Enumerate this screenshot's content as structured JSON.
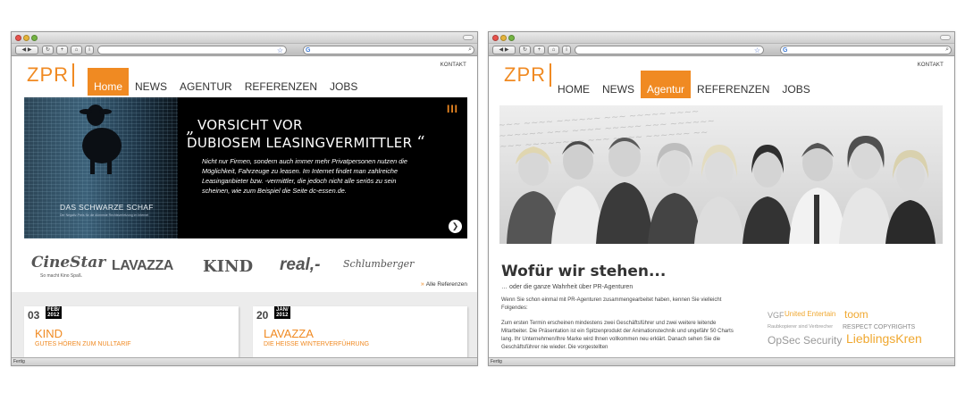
{
  "statusbar": {
    "text": "Fertig"
  },
  "left": {
    "kontakt": "KONTAKT",
    "logo": "ZPR",
    "nav": [
      "Home",
      "NEWS",
      "AGENTUR",
      "REFERENZEN",
      "JOBS"
    ],
    "active": "Home",
    "hero": {
      "title_line1": "VORSICHT VOR",
      "title_line2": "DUBIOSEM LEASINGVERMITTLER",
      "open_quote": "„",
      "close_quote": "“",
      "body": "Nicht nur Firmen, sondern auch immer mehr Privatpersonen nutzen die Möglichkeit, Fahrzeuge zu leasen. Im Internet findet man zahlreiche Leasinganbieter bzw. -vermittler, die jedoch nicht alle seriös zu sein scheinen, wie zum Beispiel die Seite dc-essen.de.",
      "image_caption": "DAS SCHWARZE SCHAF",
      "image_subcaption": "Der Negativ-Preis für die dümmste Rechtsverletzung im Internet",
      "slider_indicator": "III",
      "next_icon": "❯"
    },
    "brands": {
      "cinestar": "CineStar",
      "cinestar_tagline": "So macht Kino Spaß.",
      "lavazza": "LAVAZZA",
      "kind": "KIND",
      "real": "real,-",
      "schlumberger": "Schlumberger"
    },
    "alle_referenzen": "Alle Referenzen",
    "news": [
      {
        "day": "03",
        "month": "FEB/",
        "year": "2012",
        "title": "KIND",
        "subtitle": "GUTES HÖREN ZUM NULLTARIF"
      },
      {
        "day": "20",
        "month": "JAN/",
        "year": "2012",
        "title": "LAVAZZA",
        "subtitle": "DIE HEISSE WINTERVERFÜHRUNG"
      }
    ]
  },
  "right": {
    "kontakt": "KONTAKT",
    "logo": "ZPR",
    "nav": [
      "HOME",
      "NEWS",
      "Agentur",
      "REFERENZEN",
      "JOBS"
    ],
    "active": "Agentur",
    "heading": "Wofür wir stehen...",
    "subheading": "… oder die ganze Wahrheit über PR-Agenturen",
    "paragraph1": "Wenn Sie schon einmal mit PR-Agenturen zusammengearbeitet haben, kennen Sie vielleicht Folgendes:",
    "paragraph2": "Zum ersten Termin erscheinen mindestens zwei Geschäftsführer und zwei weitere leitende Mitarbeiter. Die Präsentation ist ein Spitzenprodukt der Animationstechnik und ungefähr 50 Charts lang. Ihr Unternehmen/Ihre Marke wird Ihnen vollkommen neu erklärt. Danach sehen Sie die Geschäftsführer nie wieder. Die vorgestellten",
    "tags": [
      "VGF",
      "United Entertain",
      "toom",
      "Raubkopierer sind Verbrecher",
      "RESPECT COPYRIGHTS",
      "OpSec Security",
      "LieblingsKren"
    ]
  }
}
